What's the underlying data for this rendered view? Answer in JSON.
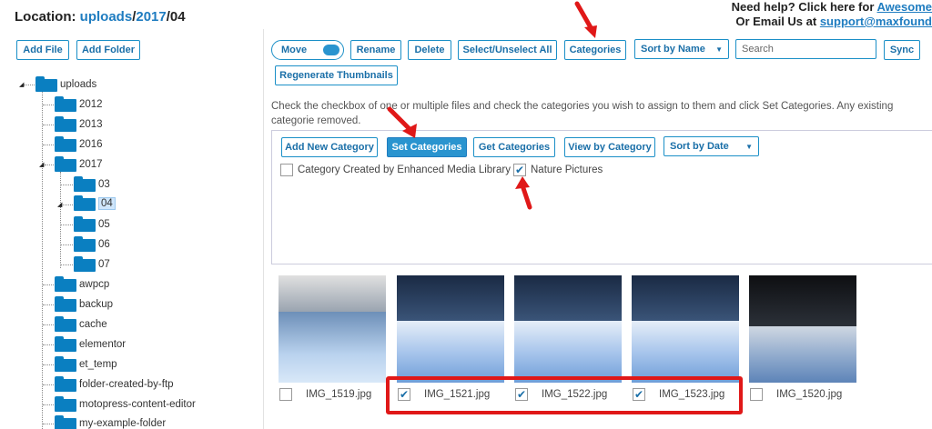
{
  "location": {
    "prefix": "Location: ",
    "part1": "uploads",
    "sep1": "/",
    "part2": "2017",
    "sep2": "/",
    "part3": "04"
  },
  "help": {
    "line1": "Need help? Click here for ",
    "link1": "Awesome",
    "line2": "Or Email Us at ",
    "link2": "support@maxfound"
  },
  "left_buttons": {
    "add_file": "Add File",
    "add_folder": "Add Folder"
  },
  "toolbar": {
    "move": "Move",
    "rename": "Rename",
    "delete": "Delete",
    "select_all": "Select/Unselect All",
    "categories": "Categories",
    "sort_name": "Sort by Name",
    "search_placeholder": "Search",
    "sync": "Sync",
    "regenerate": "Regenerate Thumbnails"
  },
  "instructions": "Check the checkbox of one or multiple files and check the categories you wish to assign to them and click Set Categories. Any existing categorie removed.",
  "category_toolbar": {
    "add_new": "Add New Category",
    "set": "Set Categories",
    "get": "Get Categories",
    "view": "View by Category",
    "sort_date": "Sort by Date"
  },
  "categories": [
    {
      "label": "Category Created by Enhanced Media Library",
      "checked": false
    },
    {
      "label": "Nature Pictures",
      "checked": true
    }
  ],
  "tree": {
    "root": "uploads",
    "years": [
      "2012",
      "2013",
      "2016",
      "2017"
    ],
    "months": [
      "03",
      "04",
      "05",
      "06",
      "07"
    ],
    "others": [
      "awpcp",
      "backup",
      "cache",
      "elementor",
      "et_temp",
      "folder-created-by-ftp",
      "motopress-content-editor",
      "my-example-folder"
    ]
  },
  "files": [
    {
      "name": "IMG_1519.jpg",
      "checked": false
    },
    {
      "name": "IMG_1521.jpg",
      "checked": true
    },
    {
      "name": "IMG_1522.jpg",
      "checked": true
    },
    {
      "name": "IMG_1523.jpg",
      "checked": true
    },
    {
      "name": "IMG_1520.jpg",
      "checked": false
    }
  ],
  "colors": {
    "accent": "#2a94cf",
    "folder": "#0a7fc1",
    "annotation": "#e01818"
  }
}
